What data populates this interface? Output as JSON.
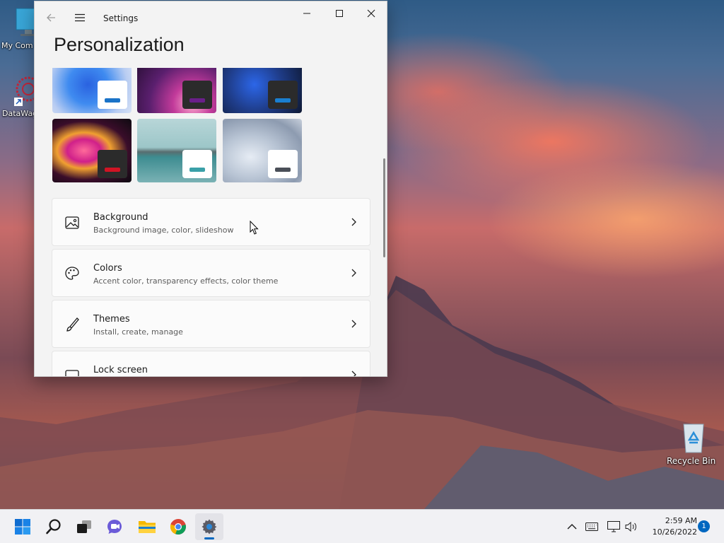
{
  "desktop": {
    "icons": [
      {
        "label": "My Com"
      },
      {
        "label": "DataWag"
      }
    ],
    "recycle_bin": {
      "label": "Recycle Bin"
    }
  },
  "window": {
    "app_title": "Settings",
    "page_title": "Personalization",
    "controls": {
      "minimize": "minimize-icon",
      "maximize": "maximize-icon",
      "close": "close-icon"
    }
  },
  "themes": [
    {
      "name": "theme-windows-light-bloom",
      "bg": "#3b6fd8",
      "mini_bg": "#ffffff",
      "accent": "#1a73c8"
    },
    {
      "name": "theme-glow",
      "bg": "#5a1f6e",
      "mini_bg": "#2b2b2b",
      "accent": "#6a1f8a"
    },
    {
      "name": "theme-windows-dark-bloom",
      "bg": "#1f3d8a",
      "mini_bg": "#2b2b2b",
      "accent": "#1a7fd0"
    },
    {
      "name": "theme-captured-motion",
      "bg": "#1a1016",
      "mini_bg": "#2b2b2b",
      "accent": "#d01424"
    },
    {
      "name": "theme-sunrise",
      "bg": "#6fa6a8",
      "mini_bg": "#ffffff",
      "accent": "#3aa0a8"
    },
    {
      "name": "theme-flow",
      "bg": "#a9b5c6",
      "mini_bg": "#ffffff",
      "accent": "#4a4f58"
    }
  ],
  "settings_items": [
    {
      "title": "Background",
      "subtitle": "Background image, color, slideshow",
      "icon": "image-icon"
    },
    {
      "title": "Colors",
      "subtitle": "Accent color, transparency effects, color theme",
      "icon": "palette-icon"
    },
    {
      "title": "Themes",
      "subtitle": "Install, create, manage",
      "icon": "brush-icon"
    },
    {
      "title": "Lock screen",
      "subtitle": "",
      "icon": "lock-screen-icon"
    }
  ],
  "taskbar": {
    "apps": [
      "start-icon",
      "search-icon",
      "task-view-icon",
      "chat-icon",
      "file-explorer-icon",
      "chrome-icon",
      "settings-icon"
    ],
    "clock_time": "2:59 AM",
    "clock_date": "10/26/2022",
    "notification_count": "1"
  },
  "colors": {
    "accent": "#0067c0"
  }
}
